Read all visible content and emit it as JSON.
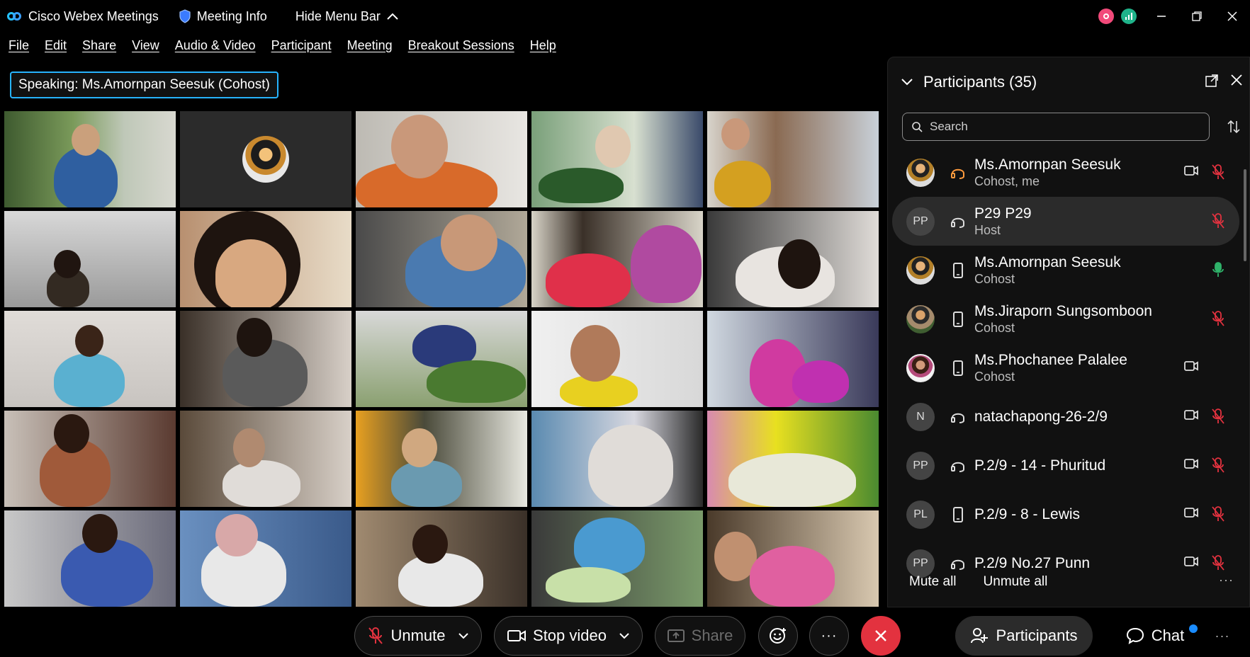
{
  "titlebar": {
    "app_title": "Cisco Webex Meetings",
    "meeting_info": "Meeting Info",
    "hide_menu": "Hide Menu Bar",
    "colors": {
      "recording": "#f24a7a",
      "stats": "#1fb38a"
    }
  },
  "menu": [
    "File",
    "Edit",
    "Share",
    "View",
    "Audio & Video",
    "Participant",
    "Meeting",
    "Breakout Sessions",
    "Help"
  ],
  "speaking": {
    "label": "Speaking:",
    "name": "Ms.Amornpan Seesuk (Cohost)"
  },
  "panel": {
    "title": "Participants (35)",
    "search_placeholder": "Search",
    "participants": [
      {
        "name": "Ms.Amornpan Seesuk",
        "role": "Cohost, me",
        "avatar": "",
        "device": "headset-icon",
        "device_color": "#ff9b3d",
        "camera": true,
        "mic": "muted"
      },
      {
        "name": "P29 P29",
        "role": "Host",
        "avatar": "PP",
        "device": "headset-icon",
        "camera": false,
        "mic": "muted",
        "selected": true
      },
      {
        "name": "Ms.Amornpan Seesuk",
        "role": "Cohost",
        "avatar": "",
        "device": "phone-icon",
        "camera": false,
        "mic": "active"
      },
      {
        "name": "Ms.Jiraporn Sungsomboon",
        "role": "Cohost",
        "avatar": "",
        "device": "phone-icon",
        "camera": false,
        "mic": "muted"
      },
      {
        "name": "Ms.Phochanee Palalee",
        "role": "Cohost",
        "avatar": "",
        "device": "phone-icon",
        "camera": true,
        "mic": "none"
      },
      {
        "name": "natachapong-26-2/9",
        "role": "",
        "avatar": "N",
        "device": "headset-icon",
        "camera": true,
        "mic": "muted"
      },
      {
        "name": "P.2/9 - 14 - Phuritud",
        "role": "",
        "avatar": "PP",
        "device": "headset-icon",
        "camera": true,
        "mic": "muted"
      },
      {
        "name": "P.2/9 - 8 - Lewis",
        "role": "",
        "avatar": "PL",
        "device": "phone-icon",
        "camera": true,
        "mic": "muted"
      },
      {
        "name": "P.2/9 No.27 Punn",
        "role": "",
        "avatar": "PP",
        "device": "headset-icon",
        "camera": true,
        "mic": "muted"
      }
    ],
    "mute_all": "Mute all",
    "unmute_all": "Unmute all"
  },
  "controls": {
    "unmute": "Unmute",
    "stop_video": "Stop video",
    "share": "Share",
    "participants": "Participants",
    "chat": "Chat",
    "end_color": "#e3323f"
  }
}
